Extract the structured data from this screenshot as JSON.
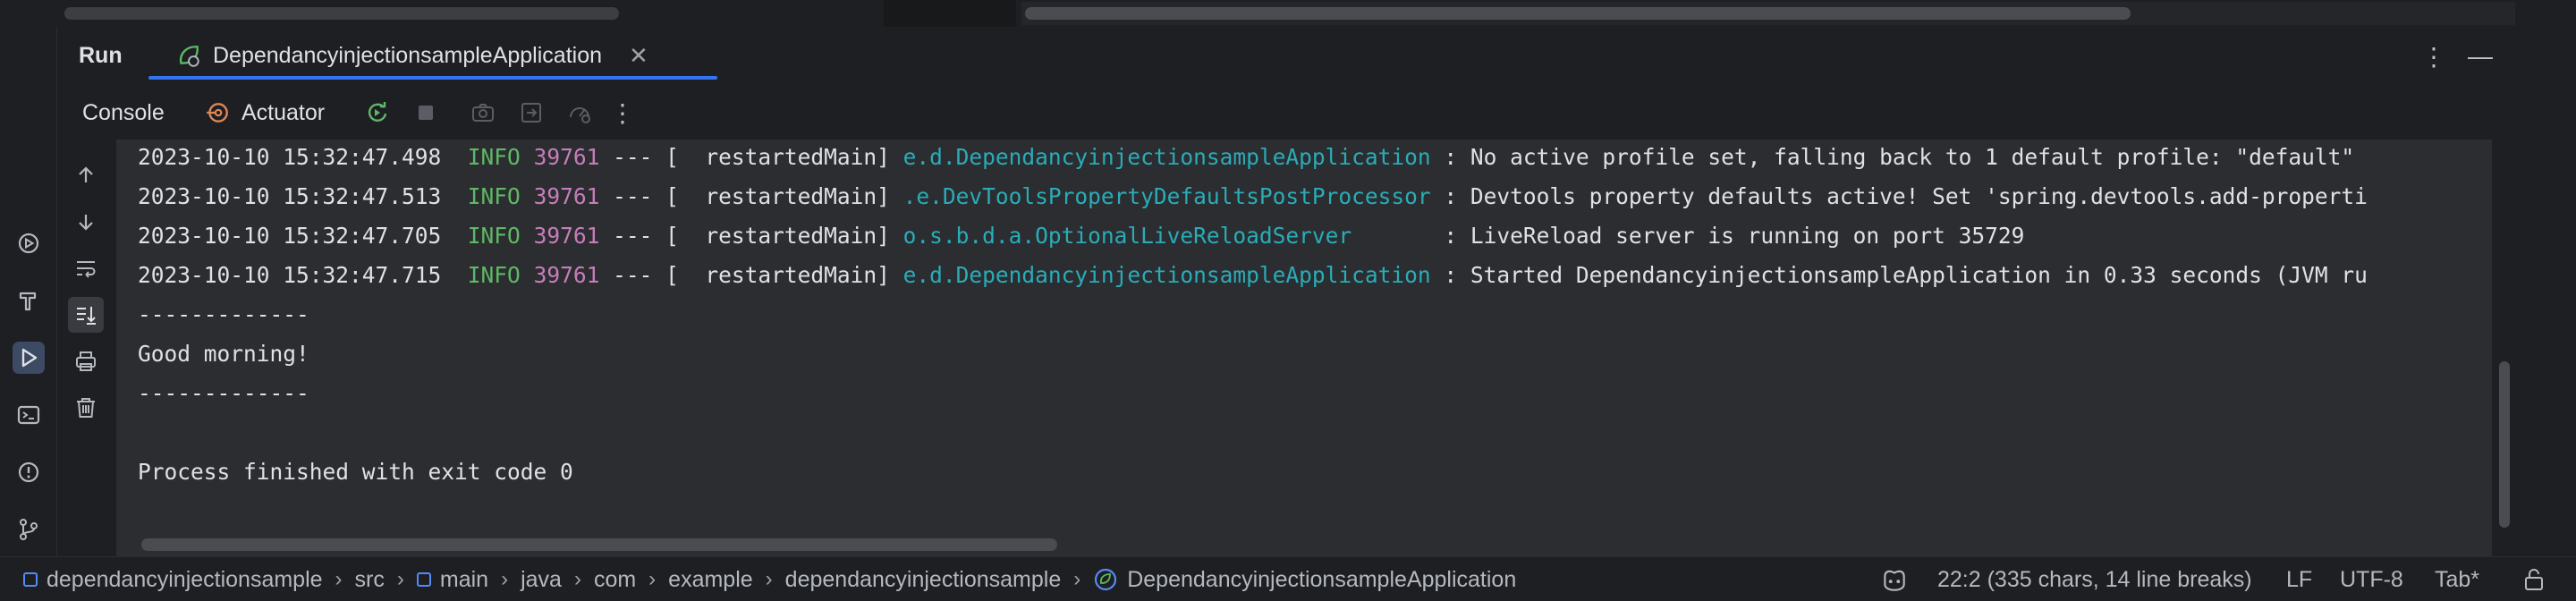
{
  "run_panel": {
    "title": "Run",
    "tab_label": "DependancyinjectionsampleApplication"
  },
  "toolbar": {
    "console_tab": "Console",
    "actuator_tab": "Actuator"
  },
  "console": {
    "logs": [
      {
        "timestamp": "2023-10-10 15:32:47.498",
        "level": "INFO",
        "pid": "39761",
        "thread": "--- [  restartedMain]",
        "logger": "e.d.DependancyinjectionsampleApplication",
        "message": ": No active profile set, falling back to 1 default profile: \"default\""
      },
      {
        "timestamp": "2023-10-10 15:32:47.513",
        "level": "INFO",
        "pid": "39761",
        "thread": "--- [  restartedMain]",
        "logger": ".e.DevToolsPropertyDefaultsPostProcessor",
        "message": ": Devtools property defaults active! Set 'spring.devtools.add-properti"
      },
      {
        "timestamp": "2023-10-10 15:32:47.705",
        "level": "INFO",
        "pid": "39761",
        "thread": "--- [  restartedMain]",
        "logger": "o.s.b.d.a.OptionalLiveReloadServer      ",
        "message": ": LiveReload server is running on port 35729"
      },
      {
        "timestamp": "2023-10-10 15:32:47.715",
        "level": "INFO",
        "pid": "39761",
        "thread": "--- [  restartedMain]",
        "logger": "e.d.DependancyinjectionsampleApplication",
        "message": ": Started DependancyinjectionsampleApplication in 0.33 seconds (JVM ru"
      }
    ],
    "separator_1": "-------------",
    "greeting": "Good morning!",
    "separator_2": "-------------",
    "exit_message": "Process finished with exit code 0"
  },
  "status_bar": {
    "breadcrumbs": [
      "dependancyinjectionsample",
      "src",
      "main",
      "java",
      "com",
      "example",
      "dependancyinjectionsample",
      "DependancyinjectionsampleApplication"
    ],
    "position": "22:2 (335 chars, 14 line breaks)",
    "line_separator": "LF",
    "encoding": "UTF-8",
    "indent": "Tab*"
  },
  "colors": {
    "accent": "#3574f0",
    "info_level": "#5fb865",
    "pid": "#c77dbb",
    "logger": "#2aacb8"
  }
}
